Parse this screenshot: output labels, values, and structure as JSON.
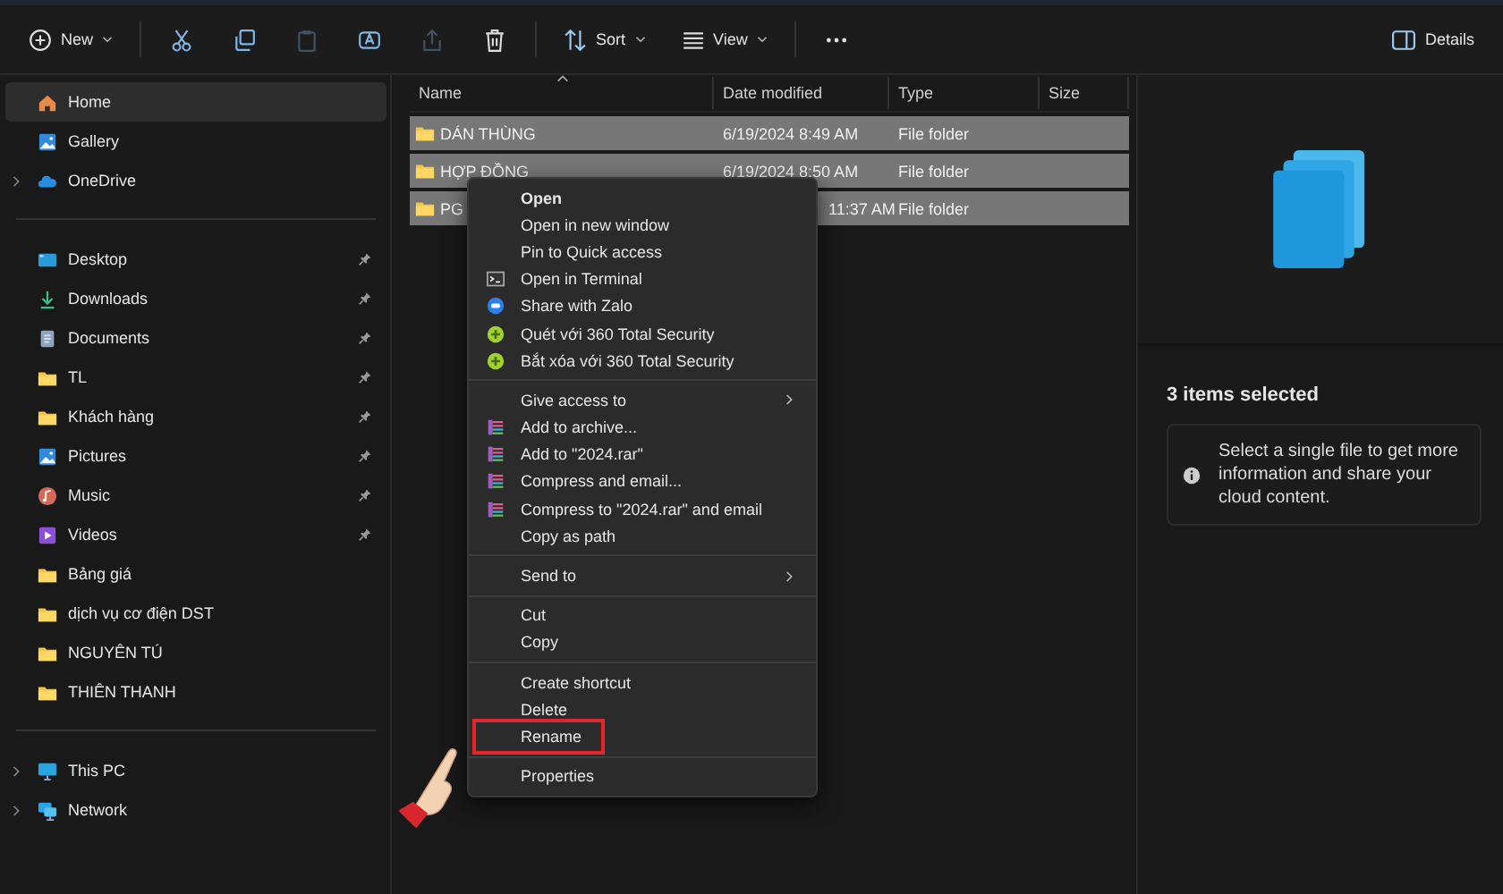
{
  "toolbar": {
    "items": [
      {
        "kind": "new",
        "label": "New",
        "disabled": false
      },
      {
        "kind": "separator"
      },
      {
        "kind": "cut",
        "disabled": false
      },
      {
        "kind": "copy",
        "disabled": false
      },
      {
        "kind": "paste",
        "disabled": true
      },
      {
        "kind": "rename",
        "disabled": false
      },
      {
        "kind": "share",
        "disabled": true
      },
      {
        "kind": "delete",
        "disabled": false
      },
      {
        "kind": "separator"
      },
      {
        "kind": "sort",
        "label": "Sort",
        "disabled": false
      },
      {
        "kind": "view",
        "label": "View",
        "disabled": false
      },
      {
        "kind": "separator"
      },
      {
        "kind": "more",
        "disabled": false
      }
    ],
    "details": {
      "label": "Details"
    }
  },
  "sidebar": {
    "sections": [
      [
        {
          "label": "Home",
          "kind": "home",
          "selected": true,
          "expandable": false,
          "pinned": false
        },
        {
          "label": "Gallery",
          "kind": "gallery",
          "selected": false,
          "expandable": false,
          "pinned": false
        },
        {
          "label": "OneDrive",
          "kind": "cloud",
          "selected": false,
          "expandable": true,
          "pinned": false
        }
      ],
      [
        {
          "label": "Desktop",
          "kind": "desktop",
          "selected": false,
          "expandable": false,
          "pinned": true
        },
        {
          "label": "Downloads",
          "kind": "download",
          "selected": false,
          "expandable": false,
          "pinned": true
        },
        {
          "label": "Documents",
          "kind": "document",
          "selected": false,
          "expandable": false,
          "pinned": true
        },
        {
          "label": "TL",
          "kind": "folder",
          "selected": false,
          "expandable": false,
          "pinned": true
        },
        {
          "label": "Khách hàng",
          "kind": "folder",
          "selected": false,
          "expandable": false,
          "pinned": true
        },
        {
          "label": "Pictures",
          "kind": "pictures",
          "selected": false,
          "expandable": false,
          "pinned": true
        },
        {
          "label": "Music",
          "kind": "music",
          "selected": false,
          "expandable": false,
          "pinned": true
        },
        {
          "label": "Videos",
          "kind": "video",
          "selected": false,
          "expandable": false,
          "pinned": true
        },
        {
          "label": "Bảng giá",
          "kind": "folder",
          "selected": false,
          "expandable": false,
          "pinned": false
        },
        {
          "label": "dịch vụ cơ điện DST",
          "kind": "folder",
          "selected": false,
          "expandable": false,
          "pinned": false
        },
        {
          "label": "NGUYÊN TÚ",
          "kind": "folder",
          "selected": false,
          "expandable": false,
          "pinned": false
        },
        {
          "label": "THIÊN THANH",
          "kind": "folder",
          "selected": false,
          "expandable": false,
          "pinned": false
        }
      ],
      [
        {
          "label": "This PC",
          "kind": "pc",
          "selected": false,
          "expandable": true,
          "pinned": false
        },
        {
          "label": "Network",
          "kind": "network",
          "selected": false,
          "expandable": true,
          "pinned": false
        }
      ]
    ]
  },
  "table": {
    "columns": [
      "Name",
      "Date modified",
      "Type",
      "Size"
    ],
    "rows": [
      {
        "name": "DÁN THÙNG",
        "date": "6/19/2024 8:49 AM",
        "type": "File folder",
        "selected": true
      },
      {
        "name": "HỢP ĐỒNG",
        "date": "6/19/2024 8:50 AM",
        "type": "File folder",
        "selected": true
      },
      {
        "name": "PG",
        "date": "11:37 AM",
        "type": "File folder",
        "selected": true
      }
    ]
  },
  "context_menu": {
    "groups": [
      [
        {
          "label": "Open",
          "kind": "plain",
          "default": true,
          "submenu": false,
          "highlighted": false
        },
        {
          "label": "Open in new window",
          "kind": "plain",
          "default": false,
          "submenu": false,
          "highlighted": false
        },
        {
          "label": "Pin to Quick access",
          "kind": "plain",
          "default": false,
          "submenu": false,
          "highlighted": false
        },
        {
          "label": "Open in Terminal",
          "kind": "terminal",
          "default": false,
          "submenu": false,
          "highlighted": false
        },
        {
          "label": "Share with Zalo",
          "kind": "zalo",
          "default": false,
          "submenu": false,
          "highlighted": false
        },
        {
          "label": "Quét với 360 Total Security",
          "kind": "security",
          "default": false,
          "submenu": false,
          "highlighted": false
        },
        {
          "label": "Bắt xóa với 360 Total Security",
          "kind": "security",
          "default": false,
          "submenu": false,
          "highlighted": false
        }
      ],
      [
        {
          "label": "Give access to",
          "kind": "plain",
          "default": false,
          "submenu": true,
          "highlighted": false
        },
        {
          "label": "Add to archive...",
          "kind": "archive",
          "default": false,
          "submenu": false,
          "highlighted": false
        },
        {
          "label": "Add to \"2024.rar\"",
          "kind": "archive",
          "default": false,
          "submenu": false,
          "highlighted": false
        },
        {
          "label": "Compress and email...",
          "kind": "archive",
          "default": false,
          "submenu": false,
          "highlighted": false
        },
        {
          "label": "Compress to \"2024.rar\" and email",
          "kind": "archive",
          "default": false,
          "submenu": false,
          "highlighted": false
        },
        {
          "label": "Copy as path",
          "kind": "plain",
          "default": false,
          "submenu": false,
          "highlighted": false
        }
      ],
      [
        {
          "label": "Send to",
          "kind": "plain",
          "default": false,
          "submenu": true,
          "highlighted": false
        }
      ],
      [
        {
          "label": "Cut",
          "kind": "plain",
          "default": false,
          "submenu": false,
          "highlighted": false
        },
        {
          "label": "Copy",
          "kind": "plain",
          "default": false,
          "submenu": false,
          "highlighted": false
        }
      ],
      [
        {
          "label": "Create shortcut",
          "kind": "plain",
          "default": false,
          "submenu": false,
          "highlighted": false
        },
        {
          "label": "Delete",
          "kind": "plain",
          "default": false,
          "submenu": false,
          "highlighted": false
        },
        {
          "label": "Rename",
          "kind": "plain",
          "default": false,
          "submenu": false,
          "highlighted": true
        }
      ],
      [
        {
          "label": "Properties",
          "kind": "plain",
          "default": false,
          "submenu": false,
          "highlighted": false
        }
      ]
    ]
  },
  "details_pane": {
    "title": "3 items selected",
    "info": "Select a single file to get more information and share your cloud content."
  }
}
